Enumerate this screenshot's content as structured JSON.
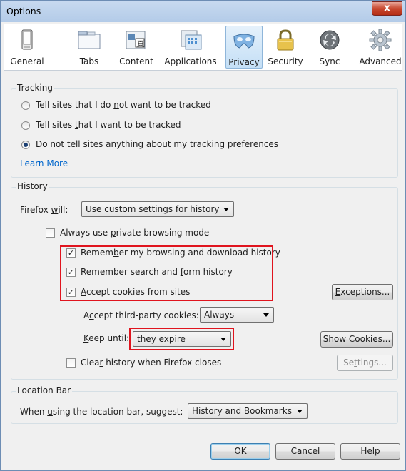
{
  "window": {
    "title": "Options",
    "close_label": "x"
  },
  "toolbar": {
    "tabs": [
      {
        "label": "General",
        "icon": "general-icon"
      },
      {
        "label": "Tabs",
        "icon": "tabs-icon"
      },
      {
        "label": "Content",
        "icon": "content-icon"
      },
      {
        "label": "Applications",
        "icon": "applications-icon"
      },
      {
        "label": "Privacy",
        "icon": "privacy-mask-icon",
        "selected": true
      },
      {
        "label": "Security",
        "icon": "padlock-icon"
      },
      {
        "label": "Sync",
        "icon": "sync-icon"
      },
      {
        "label": "Advanced",
        "icon": "gear-icon"
      }
    ]
  },
  "tracking": {
    "legend": "Tracking",
    "options": [
      {
        "a": "Tell sites that I do ",
        "u": "n",
        "b": "ot want to be tracked",
        "checked": false
      },
      {
        "a": "Tell sites ",
        "u": "t",
        "b": "hat I want to be tracked",
        "checked": false
      },
      {
        "a": "D",
        "u": "o",
        "b": " not tell sites anything about my tracking preferences",
        "checked": true
      }
    ],
    "learn_more": "Learn More"
  },
  "history": {
    "legend": "History",
    "firefox_will_a": "Firefox ",
    "firefox_will_u": "w",
    "firefox_will_b": "ill:",
    "mode_value": "Use custom settings for history",
    "private_a": "Always use ",
    "private_u": "p",
    "private_b": "rivate browsing mode",
    "remember_browsing_a": "Remem",
    "remember_browsing_u": "b",
    "remember_browsing_b": "er my browsing and download history",
    "remember_search_a": "Remember search and ",
    "remember_search_u": "f",
    "remember_search_b": "orm history",
    "accept_cookies_u": "A",
    "accept_cookies_b": "ccept cookies from sites",
    "exceptions_u": "E",
    "exceptions_b": "xceptions...",
    "third_party_a": "A",
    "third_party_u": "c",
    "third_party_b": "cept third-party cookies:",
    "third_party_value": "Always",
    "keep_until_u": "K",
    "keep_until_b": "eep until:",
    "keep_until_value": "they expire",
    "show_cookies_u": "S",
    "show_cookies_b": "how Cookies...",
    "clear_a": "Clea",
    "clear_u": "r",
    "clear_b": " history when Firefox closes",
    "settings_a": "Se",
    "settings_u": "t",
    "settings_b": "tings..."
  },
  "location_bar": {
    "legend": "Location Bar",
    "suggest_a": "When ",
    "suggest_u": "u",
    "suggest_b": "sing the location bar, suggest:",
    "suggest_value": "History and Bookmarks"
  },
  "footer": {
    "ok": "OK",
    "cancel": "Cancel",
    "help_u": "H",
    "help_b": "elp"
  },
  "colors": {
    "highlight": "#e0141e",
    "link": "#0066cc",
    "selected_tab": "#c4dff6"
  }
}
